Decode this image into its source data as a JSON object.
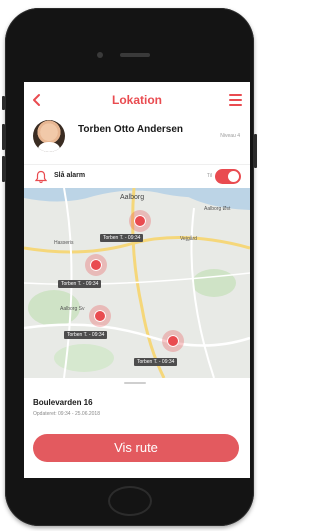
{
  "header": {
    "title": "Lokation",
    "back_icon": "chevron-left-icon",
    "menu_icon": "hamburger-menu-icon"
  },
  "profile": {
    "name": "Torben Otto Andersen",
    "level": "Niveau 4"
  },
  "alarm": {
    "label": "Slå alarm",
    "state_label": "Til",
    "enabled": true,
    "icon": "bell-icon"
  },
  "map": {
    "labels": [
      "Aalborg",
      "Hasseris",
      "Vejgård",
      "Aalborg Øst",
      "Aalborg Sv"
    ],
    "markers": [
      {
        "label": "Torben T. - 09:34"
      },
      {
        "label": "Torben T. - 09:34"
      },
      {
        "label": "Torben T. - 09:34"
      },
      {
        "label": "Torben T. - 09:34"
      }
    ]
  },
  "location_card": {
    "address": "Boulevarden 16",
    "updated": "Opdateret: 09:34 - 25.06.2018"
  },
  "route_button": {
    "label": "Vis rute"
  },
  "colors": {
    "accent": "#e94b50",
    "button": "#e35a5f",
    "badge": "#4d4d4d"
  }
}
